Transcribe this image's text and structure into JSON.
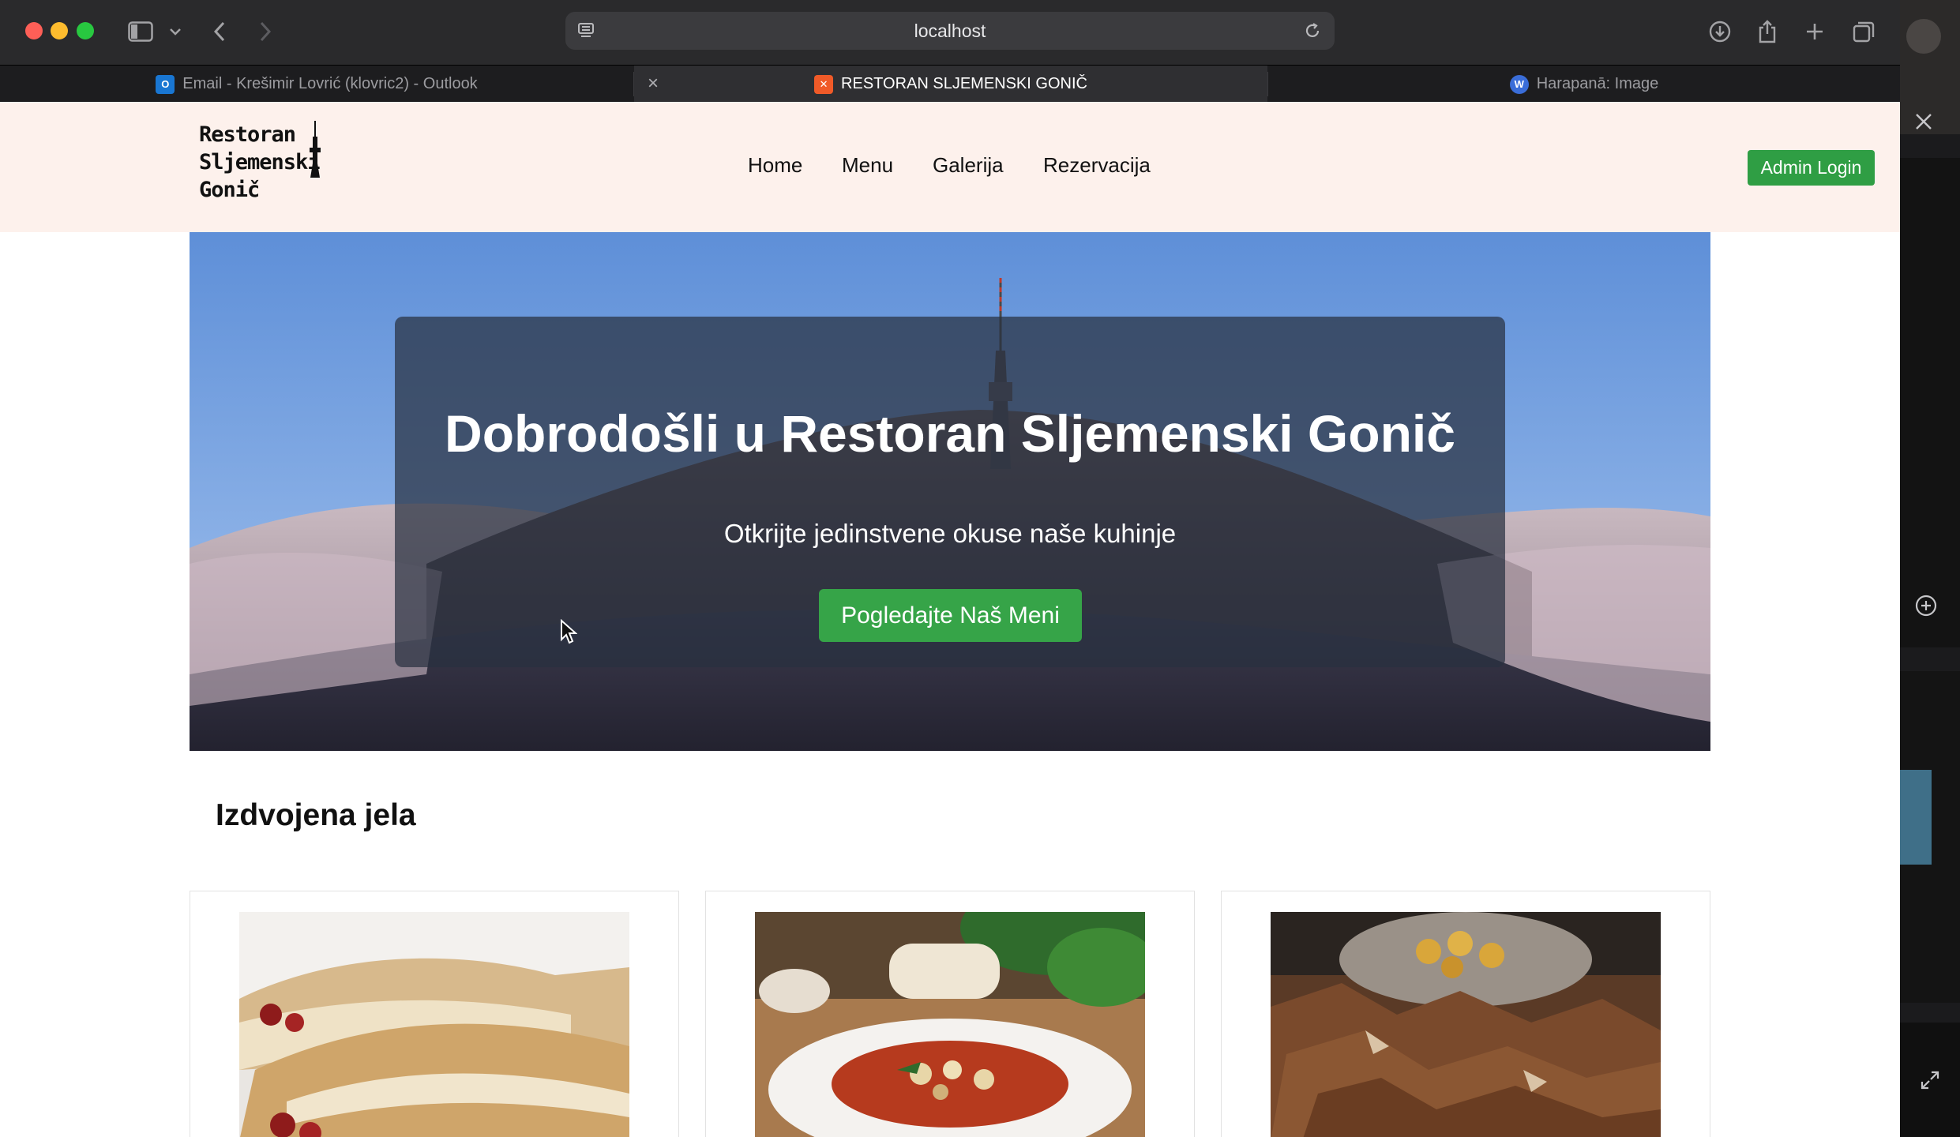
{
  "browser": {
    "url": "localhost",
    "tabs": [
      {
        "title": "Email - Krešimir Lovrić (klovric2) - Outlook",
        "favicon": "outlook-icon",
        "active": false
      },
      {
        "title": "RESTORAN SLJEMENSKI GONIČ",
        "favicon": "xampp-icon",
        "active": true
      },
      {
        "title": "Harapanā: Image",
        "favicon": "wordpress-icon",
        "active": false
      }
    ],
    "tab_close_glyph": "×"
  },
  "site": {
    "logo": {
      "line1": "Restoran",
      "line2": "Sljemenski",
      "line3": "Gonič"
    },
    "nav": [
      "Home",
      "Menu",
      "Galerija",
      "Rezervacija"
    ],
    "admin_button": "Admin Login",
    "hero": {
      "title": "Dobrodošli u Restoran Sljemenski Gonič",
      "subtitle": "Otkrijte jedinstvene okuse naše kuhinje",
      "button": "Pogledajte Naš Meni"
    },
    "featured_title": "Izdvojena jela",
    "dishes": [
      {
        "name": "strudel-image"
      },
      {
        "name": "stew-image"
      },
      {
        "name": "roast-meat-image"
      }
    ]
  },
  "colors": {
    "accent_green": "#2f9e44",
    "header_bg": "#fdf1ec",
    "browser_chrome": "#2a2a2c"
  }
}
